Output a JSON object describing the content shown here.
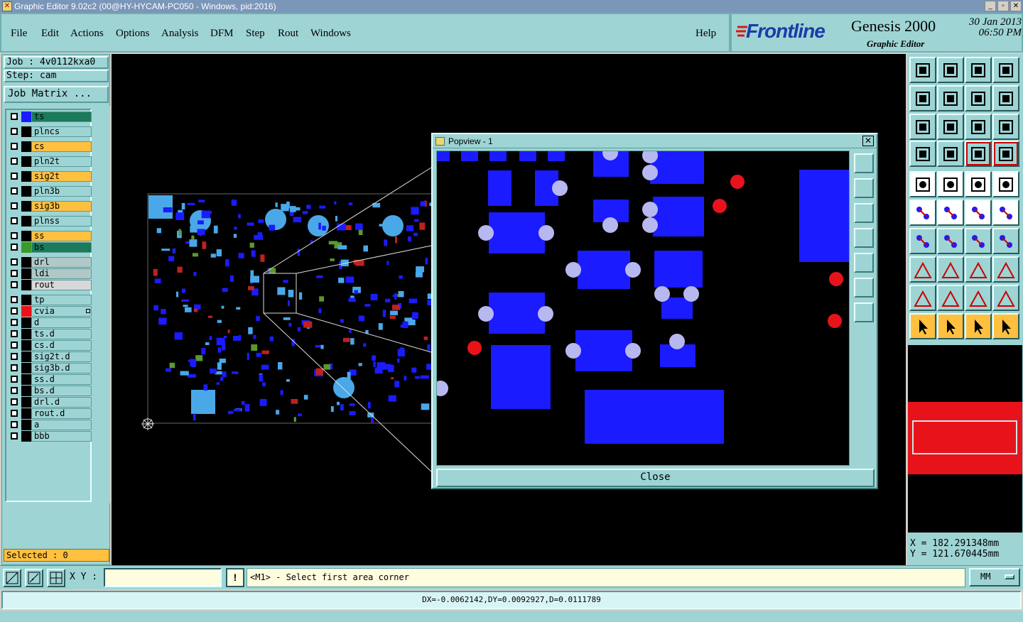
{
  "window": {
    "title": "Graphic Editor 9.02c2 (00@HY-HYCAM-PC050 - Windows, pid:2016)",
    "controls": [
      "_",
      "▫",
      "✕"
    ]
  },
  "menu": [
    "File",
    "Edit",
    "Actions",
    "Options",
    "Analysis",
    "DFM",
    "Step",
    "Rout",
    "Windows"
  ],
  "help_label": "Help",
  "brand": {
    "logo": "Frontline",
    "product": "Genesis 2000",
    "subtitle": "Graphic Editor",
    "date": "30 Jan 2013",
    "time": "06:50 PM"
  },
  "job": {
    "job_label": "Job : 4v0112kxa0",
    "step_label": "Step: cam",
    "matrix_button": "Job Matrix ..."
  },
  "layers": [
    {
      "name": "ts",
      "color": "#1a7a5a",
      "swatch": "#1b1bff",
      "affected": false
    },
    {
      "name": "plncs",
      "color": "#9ed4d4",
      "swatch": "#000000",
      "affected": false
    },
    {
      "name": "cs",
      "color": "#ffc040",
      "swatch": "#000000",
      "affected": false
    },
    {
      "name": "pln2t",
      "color": "#9ed4d4",
      "swatch": "#000000",
      "affected": false
    },
    {
      "name": "sig2t",
      "color": "#ffc040",
      "swatch": "#000000",
      "affected": false
    },
    {
      "name": "pln3b",
      "color": "#9ed4d4",
      "swatch": "#000000",
      "affected": false
    },
    {
      "name": "sig3b",
      "color": "#ffc040",
      "swatch": "#000000",
      "affected": false
    },
    {
      "name": "plnss",
      "color": "#9ed4d4",
      "swatch": "#000000",
      "affected": false
    },
    {
      "name": "ss",
      "color": "#ffc040",
      "swatch": "#000000",
      "affected": false
    },
    {
      "name": "bs",
      "color": "#1a7a5a",
      "swatch": "#3a9a2a",
      "affected": false
    },
    {
      "name": "drl",
      "color": "#b0c8c8",
      "swatch": "#000000",
      "affected": false
    },
    {
      "name": "ldi",
      "color": "#b0c8c8",
      "swatch": "#000000",
      "affected": false
    },
    {
      "name": "rout",
      "color": "#d8d8d8",
      "swatch": "#000000",
      "affected": false
    },
    {
      "name": "tp",
      "color": "#9ed4d4",
      "swatch": "#000000",
      "affected": false
    },
    {
      "name": "cvia",
      "color": "#9ed4d4",
      "swatch": "#e8131a",
      "affected": true
    },
    {
      "name": "d",
      "color": "#9ed4d4",
      "swatch": "#000000",
      "affected": false
    },
    {
      "name": "ts.d",
      "color": "#9ed4d4",
      "swatch": "#000000",
      "affected": false
    },
    {
      "name": "cs.d",
      "color": "#9ed4d4",
      "swatch": "#000000",
      "affected": false
    },
    {
      "name": "sig2t.d",
      "color": "#9ed4d4",
      "swatch": "#000000",
      "affected": false
    },
    {
      "name": "sig3b.d",
      "color": "#9ed4d4",
      "swatch": "#000000",
      "affected": false
    },
    {
      "name": "ss.d",
      "color": "#9ed4d4",
      "swatch": "#000000",
      "affected": false
    },
    {
      "name": "bs.d",
      "color": "#9ed4d4",
      "swatch": "#000000",
      "affected": false
    },
    {
      "name": "drl.d",
      "color": "#9ed4d4",
      "swatch": "#000000",
      "affected": false
    },
    {
      "name": "rout.d",
      "color": "#9ed4d4",
      "swatch": "#000000",
      "affected": false
    },
    {
      "name": "a",
      "color": "#9ed4d4",
      "swatch": "#000000",
      "affected": false
    },
    {
      "name": "bbb",
      "color": "#9ed4d4",
      "swatch": "#000000",
      "affected": false
    }
  ],
  "selected": "Selected : 0",
  "popview": {
    "title": "Popview - 1",
    "close_label": "Close"
  },
  "coordinates": {
    "x": "X = 182.291348mm",
    "y": "Y = 121.670445mm"
  },
  "bottom": {
    "xy_label": "X Y :",
    "xy_value": "",
    "prompt": "<M1> - Select first area corner",
    "units": "MM",
    "status": "DX=-0.0062142,DY=0.0092927,D=0.0111789"
  },
  "colors": {
    "panel": "#9ed4d4",
    "pad_blue": "#1b1bff",
    "via_red": "#e8131a",
    "drill_light": "#b8b8f0",
    "selected_yellow": "#ffc040"
  }
}
